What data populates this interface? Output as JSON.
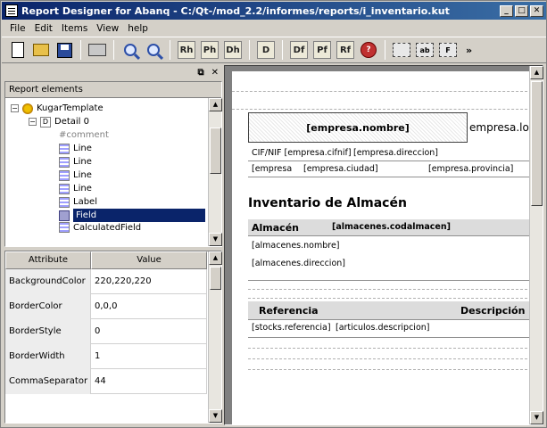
{
  "window": {
    "title": "Report Designer for Abanq - C:/Qt-/mod_2.2/informes/reports/i_inventario.kut"
  },
  "titlebar_buttons": {
    "minimize": "_",
    "maximize": "□",
    "close": "✕"
  },
  "menu": [
    "File",
    "Edit",
    "Items",
    "View",
    "help"
  ],
  "toolbar": {
    "letter_buttons": [
      "Rh",
      "Ph",
      "Dh",
      "D",
      "Df",
      "Pf",
      "Rf"
    ],
    "box_buttons": [
      "ab",
      "F"
    ],
    "more": "»"
  },
  "dock": {
    "float": "⧉",
    "close": "✕"
  },
  "tree": {
    "header": "Report elements",
    "root": "KugarTemplate",
    "detail": "Detail 0",
    "items": [
      "#comment",
      "Line",
      "Line",
      "Line",
      "Line",
      "Label",
      "Field",
      "CalculatedField"
    ],
    "selected_index": 6
  },
  "properties": {
    "columns": [
      "Attribute",
      "Value"
    ],
    "rows": [
      {
        "attr": "BackgroundColor",
        "value": "220,220,220"
      },
      {
        "attr": "BorderColor",
        "value": "0,0,0"
      },
      {
        "attr": "BorderStyle",
        "value": "0"
      },
      {
        "attr": "BorderWidth",
        "value": "1"
      },
      {
        "attr": "CommaSeparator",
        "value": "44"
      }
    ]
  },
  "report": {
    "empresa_nombre": "[empresa.nombre]",
    "empresa_logo": "empresa.logo",
    "cif": "CIF/NIF [empresa.cifnif]",
    "direccion": "[empresa.direccion]",
    "empresa": "[empresa",
    "ciudad": "[empresa.ciudad]",
    "provincia": "[empresa.provincia]",
    "title": "Inventario de Almacén",
    "almacen_label": "Almacén",
    "almacen_code": "[almacenes.codalmacen]",
    "almacen_nombre": "[almacenes.nombre]",
    "almacen_direccion": "[almacenes.direccion]",
    "col_referencia": "Referencia",
    "col_descripcion": "Descripción",
    "stocks_ref": "[stocks.referencia]",
    "articulos_desc": "[articulos.descripcion]"
  }
}
